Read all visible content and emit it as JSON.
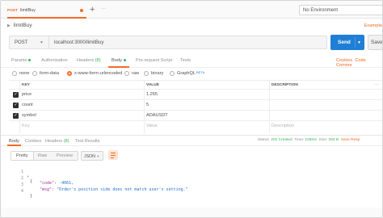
{
  "tab": {
    "method": "POST",
    "name": "limitBuy"
  },
  "new_tab_label": "+",
  "more_label": "···",
  "environment": "No Environment",
  "request": {
    "title": "limitBuy",
    "examples_label": "Example",
    "method": "POST",
    "url": "localhost:3000/limitBuy",
    "send_label": "Send",
    "save_label": "Save"
  },
  "request_tabs": {
    "params": "Params",
    "authorization": "Authorization",
    "headers": "Headers",
    "headers_count": "(8)",
    "body": "Body",
    "prerequest": "Pre-request Script",
    "tests": "Tests",
    "cookies": "Cookies",
    "code": "Code",
    "comments": "Comme"
  },
  "body_types": [
    "none",
    "form-data",
    "x-www-form-urlencoded",
    "raw",
    "binary",
    "GraphQL"
  ],
  "beta_label": "BETA",
  "selected_body_type": "x-www-form-urlencoded",
  "params_table": {
    "headers": [
      "KEY",
      "VALUE",
      "DESCRIPTION"
    ],
    "more": "···",
    "rows": [
      {
        "key": "price",
        "value": "1.265",
        "description": ""
      },
      {
        "key": "count",
        "value": "5",
        "description": ""
      },
      {
        "key": "symbol",
        "value": "ADAUSDT",
        "description": ""
      }
    ],
    "placeholder": {
      "key": "Key",
      "value": "Value",
      "description": "Description"
    }
  },
  "response_tabs": {
    "body": "Body",
    "cookies": "Cookies",
    "headers": "Headers",
    "headers_count": "(8)",
    "test_results": "Test Results"
  },
  "status": {
    "status_label": "Status:",
    "status_value": "201 Created",
    "time_label": "Time:",
    "time_value": "129ms",
    "size_label": "Size:",
    "size_value": "252 B",
    "save_response": "Save Resp"
  },
  "view_buttons": [
    "Pretty",
    "Raw",
    "Preview"
  ],
  "format": "JSON",
  "response_lines": [
    {
      "num": "1",
      "text": "{"
    },
    {
      "num": "2",
      "key": "\"code\"",
      "value": "-4061,"
    },
    {
      "num": "3",
      "key": "\"msg\"",
      "value": "\"Order's position side does not match user's setting.\""
    },
    {
      "num": "4",
      "text": "}"
    }
  ],
  "colors": {
    "accent": "#f46b26",
    "send": "#1f7fd6",
    "success": "#2eb85c"
  }
}
